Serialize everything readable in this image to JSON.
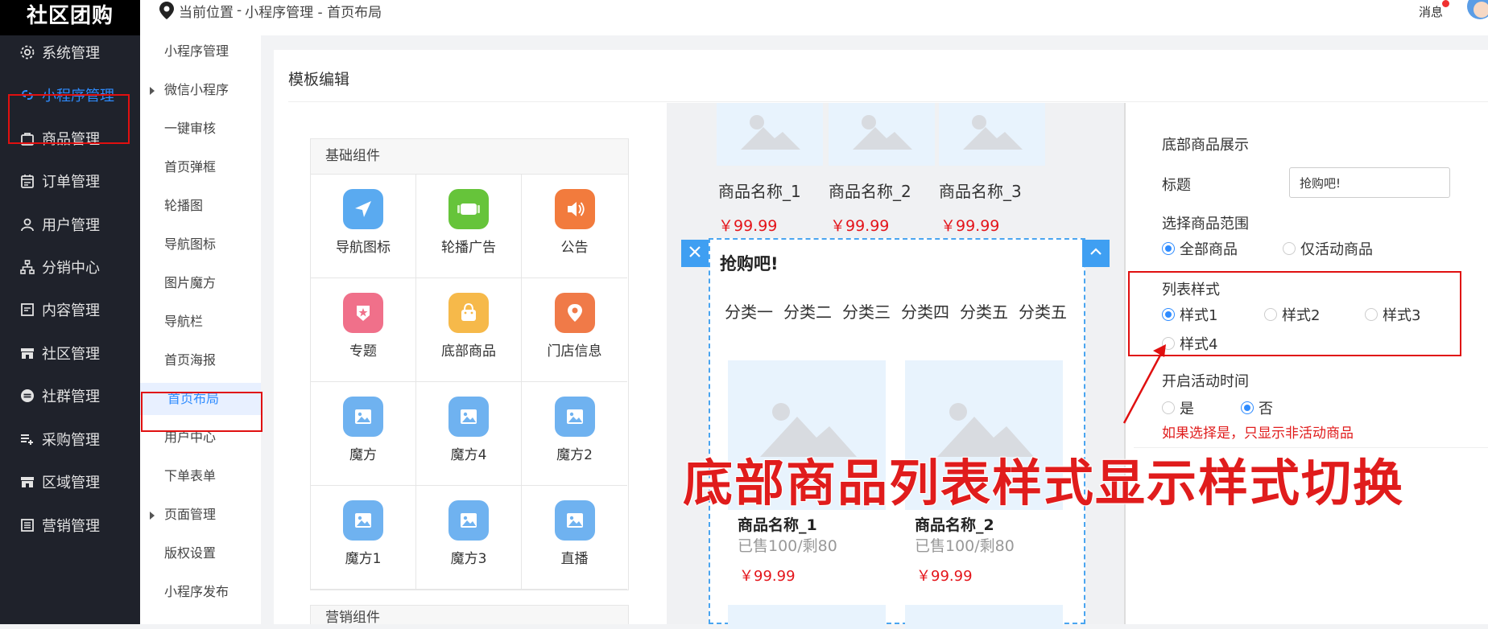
{
  "brand": "社区团购",
  "header": {
    "location_label": "当前位置",
    "breadcrumb": "小程序管理 - 首页布局",
    "message_label": "消息"
  },
  "sidebar": {
    "items": [
      {
        "label": "系统管理",
        "icon": "gear-icon"
      },
      {
        "label": "小程序管理",
        "icon": "link-icon",
        "active": true
      },
      {
        "label": "商品管理",
        "icon": "bag-icon"
      },
      {
        "label": "订单管理",
        "icon": "calendar-icon"
      },
      {
        "label": "用户管理",
        "icon": "user-icon"
      },
      {
        "label": "分销中心",
        "icon": "hierarchy-icon"
      },
      {
        "label": "内容管理",
        "icon": "document-icon"
      },
      {
        "label": "社区管理",
        "icon": "store-icon"
      },
      {
        "label": "社群管理",
        "icon": "minus-circle-icon"
      },
      {
        "label": "采购管理",
        "icon": "list-add-icon"
      },
      {
        "label": "区域管理",
        "icon": "store-icon"
      },
      {
        "label": "营销管理",
        "icon": "marketing-icon"
      }
    ]
  },
  "subnav": {
    "items": [
      {
        "label": "小程序管理",
        "expand": false
      },
      {
        "label": "微信小程序",
        "expand": true
      },
      {
        "label": "一键审核",
        "expand": false
      },
      {
        "label": "首页弹框",
        "expand": false
      },
      {
        "label": "轮播图",
        "expand": false
      },
      {
        "label": "导航图标",
        "expand": false
      },
      {
        "label": "图片魔方",
        "expand": false
      },
      {
        "label": "导航栏",
        "expand": false
      },
      {
        "label": "首页海报",
        "expand": false
      },
      {
        "label": "首页布局",
        "expand": false,
        "active": true
      },
      {
        "label": "用户中心",
        "expand": false
      },
      {
        "label": "下单表单",
        "expand": false
      },
      {
        "label": "页面管理",
        "expand": true
      },
      {
        "label": "版权设置",
        "expand": false
      },
      {
        "label": "小程序发布",
        "expand": false
      }
    ]
  },
  "panel": {
    "title": "模板编辑"
  },
  "components": {
    "header": "基础组件",
    "items": [
      {
        "label": "导航图标",
        "icon": "navigation-arrow-icon",
        "color": "#5aaaf0"
      },
      {
        "label": "轮播广告",
        "icon": "carousel-icon",
        "color": "#66c43a"
      },
      {
        "label": "公告",
        "icon": "speaker-icon",
        "color": "#f27b3d"
      },
      {
        "label": "专题",
        "icon": "badge-star-icon",
        "color": "#f0708a"
      },
      {
        "label": "底部商品",
        "icon": "shopping-bag-icon",
        "color": "#f6b94a"
      },
      {
        "label": "门店信息",
        "icon": "store-pin-icon",
        "color": "#f07a48"
      },
      {
        "label": "魔方",
        "icon": "image-icon",
        "color": "#6fb2f0"
      },
      {
        "label": "魔方4",
        "icon": "image-icon",
        "color": "#6fb2f0"
      },
      {
        "label": "魔方2",
        "icon": "image-icon",
        "color": "#6fb2f0"
      },
      {
        "label": "魔方1",
        "icon": "image-icon",
        "color": "#6fb2f0"
      },
      {
        "label": "魔方3",
        "icon": "image-icon",
        "color": "#6fb2f0"
      },
      {
        "label": "直播",
        "icon": "image-icon",
        "color": "#6fb2f0"
      }
    ],
    "marketing_header": "营销组件"
  },
  "preview": {
    "top_products": [
      {
        "name": "商品名称_1",
        "price": "￥99.99"
      },
      {
        "name": "商品名称_2",
        "price": "￥99.99"
      },
      {
        "name": "商品名称_3",
        "price": "￥99.99"
      }
    ],
    "section_title": "抢购吧!",
    "categories": [
      "分类一",
      "分类二",
      "分类三",
      "分类四",
      "分类五",
      "分类五"
    ],
    "products": [
      {
        "name": "商品名称_1",
        "sold": "已售100/剩80",
        "price": "￥99.99"
      },
      {
        "name": "商品名称_2",
        "sold": "已售100/剩80",
        "price": "￥99.99"
      }
    ]
  },
  "settings": {
    "section_title": "底部商品展示",
    "title_label": "标题",
    "title_value": "抢购吧!",
    "range_label": "选择商品范围",
    "range_options": [
      "全部商品",
      "仅活动商品"
    ],
    "range_selected": 0,
    "style_label": "列表样式",
    "style_options": [
      "样式1",
      "样式2",
      "样式3",
      "样式4"
    ],
    "style_selected": 0,
    "activity_label": "开启活动时间",
    "activity_options": [
      "是",
      "否"
    ],
    "activity_selected": 1,
    "activity_hint": "如果选择是，只显示非活动商品"
  },
  "annotation": "底部商品列表样式显示样式切换",
  "colors": {
    "accent": "#2f8cff",
    "highlight_red": "#e01010",
    "price_red": "#e4151b",
    "sidebar_bg": "#1f222b"
  }
}
